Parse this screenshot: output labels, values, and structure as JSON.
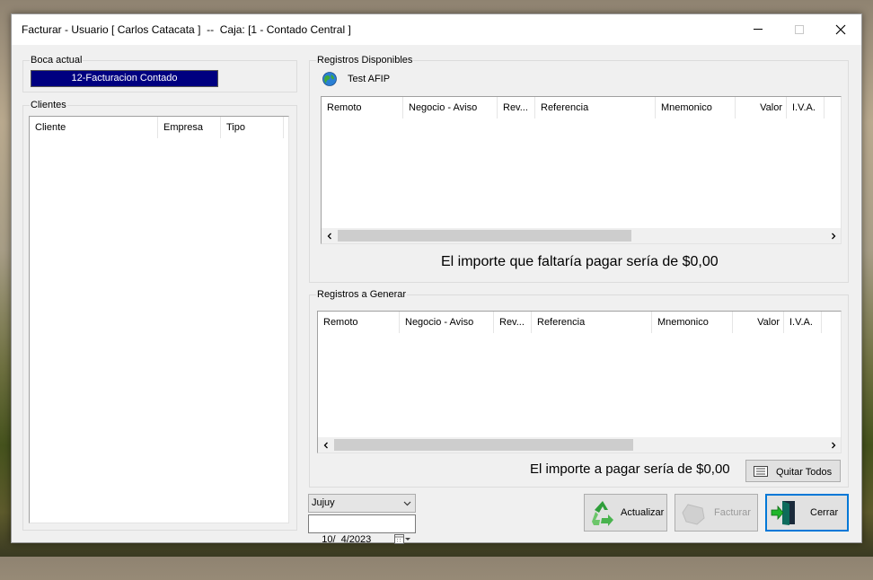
{
  "window": {
    "title": "Facturar - Usuario [ Carlos Catacata ]  --  Caja: [1 - Contado Central ]"
  },
  "boca_actual": {
    "label": "Boca actual",
    "value": "12-Facturacion Contado"
  },
  "clientes": {
    "label": "Clientes",
    "columns": [
      "Cliente",
      "Empresa",
      "Tipo"
    ]
  },
  "registros_disponibles": {
    "label": "Registros Disponibles",
    "service_label": "Test AFIP",
    "columns": [
      "Remoto",
      "Negocio - Aviso",
      "Rev...",
      "Referencia",
      "Mnemonico",
      "Valor",
      "I.V.A."
    ],
    "summary": "El importe que faltaría pagar sería de $0,00"
  },
  "registros_generar": {
    "label": "Registros a Generar",
    "columns": [
      "Remoto",
      "Negocio - Aviso",
      "Rev...",
      "Referencia",
      "Mnemonico",
      "Valor",
      "I.V.A."
    ],
    "summary": "El importe a pagar sería de $0,00",
    "quitar_todos_label": "Quitar Todos"
  },
  "footer": {
    "province": "Jujuy",
    "date": "10/  4/2023",
    "actualizar_label": "Actualizar",
    "facturar_label": "Facturar",
    "cerrar_label": "Cerrar"
  },
  "colors": {
    "selection": "#000080",
    "window_bg": "#f0f0f0",
    "accent": "#0078d7"
  }
}
